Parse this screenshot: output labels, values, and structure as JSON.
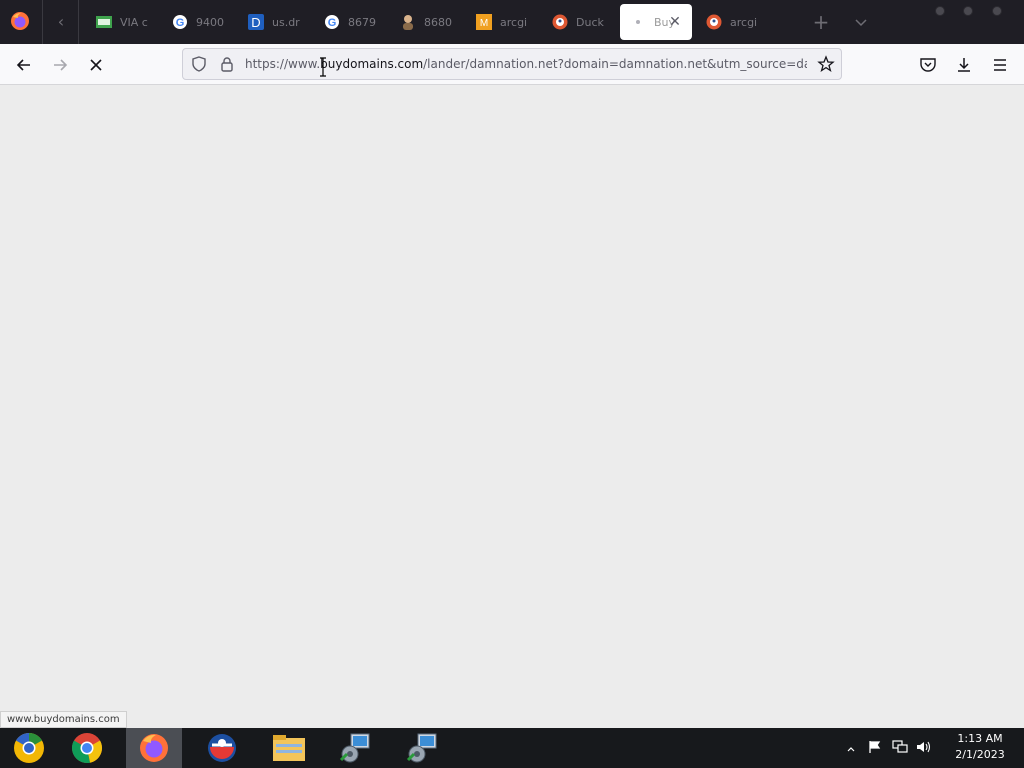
{
  "tabs": [
    {
      "title": "VIA c",
      "icon": "via-icon"
    },
    {
      "title": "9400",
      "icon": "google-icon"
    },
    {
      "title": "us.dr",
      "icon": "d-letter-icon"
    },
    {
      "title": "8679",
      "icon": "google-icon"
    },
    {
      "title": "8680",
      "icon": "person-icon"
    },
    {
      "title": "arcgi",
      "icon": "orange-m-icon"
    },
    {
      "title": "Duck",
      "icon": "duckduckgo-icon"
    },
    {
      "title": "Buy",
      "icon": "loading-dot-icon",
      "active": true
    },
    {
      "title": "arcgi",
      "icon": "duckduckgo-icon"
    }
  ],
  "toolbar": {
    "url_prefix": "https://www.",
    "url_domain": "buydomains.com",
    "url_rest": "/lander/damnation.net?domain=damnation.net&utm_source=damnat",
    "back_icon": "back-arrow-icon",
    "forward_icon": "forward-arrow-icon",
    "stop_icon": "stop-icon"
  },
  "status_link": "www.buydomains.com",
  "taskbar": {
    "apps": [
      "chrome-canary-icon",
      "chrome-icon",
      "firefox-icon",
      "opera-icon",
      "file-explorer-icon",
      "network-setup-icon",
      "network-setup-icon"
    ],
    "time": "1:13 AM",
    "date": "2/1/2023"
  },
  "colors": {
    "tabbar_bg": "#1f1e25",
    "toolbar_bg": "#f9f9fb",
    "content_bg": "#ececec",
    "taskbar_bg": "#17191c"
  }
}
